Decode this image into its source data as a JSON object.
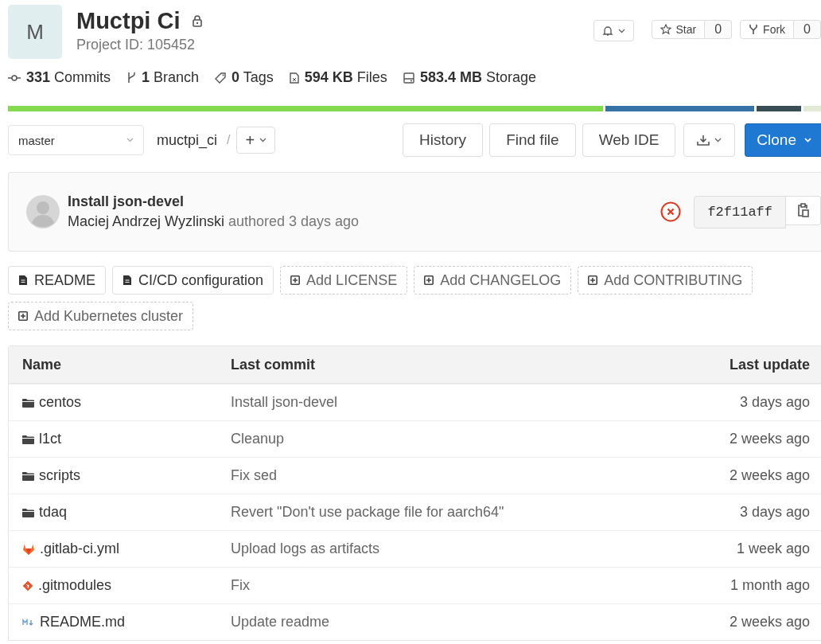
{
  "project": {
    "avatar_letter": "M",
    "name": "Muctpi Ci",
    "private": true,
    "id_text": "Project ID: 105452"
  },
  "actions": {
    "star_label": "Star",
    "star_count": "0",
    "fork_label": "Fork",
    "fork_count": "0"
  },
  "stats": [
    {
      "kind": "commit",
      "text": "**331** Commits"
    },
    {
      "kind": "branch",
      "text": "**1** Branch"
    },
    {
      "kind": "tag",
      "text": "**0** Tags"
    },
    {
      "kind": "files",
      "text": "**594 KB** Files"
    },
    {
      "kind": "storage",
      "text": "**583.4 MB** Storage"
    }
  ],
  "language_bar": [
    {
      "color": "#85d94f"
    },
    {
      "color": "#3572a5"
    },
    {
      "color": "#384d54"
    },
    {
      "color": "#e3ead6"
    }
  ],
  "repo_bar": {
    "branch": "master",
    "path": "muctpi_ci",
    "separator": "/",
    "add_label": "+",
    "buttons": [
      "History",
      "Find file",
      "Web IDE"
    ],
    "clone_label": "Clone"
  },
  "last_commit": {
    "title": "Install json-devel",
    "author": "Maciej Andrzej Wyzlinski",
    "meta": "authored 3 days ago",
    "pipeline_failed": true,
    "sha": "f2f11aff"
  },
  "shortcuts": [
    {
      "kind": "file",
      "label": "README"
    },
    {
      "kind": "file",
      "label": "CI/CD configuration"
    },
    {
      "kind": "add",
      "label": "Add LICENSE"
    },
    {
      "kind": "add",
      "label": "Add CHANGELOG"
    },
    {
      "kind": "add",
      "label": "Add CONTRIBUTING"
    },
    {
      "kind": "add",
      "label": "Add Kubernetes cluster"
    }
  ],
  "table": {
    "columns": [
      "Name",
      "Last commit",
      "Last update"
    ],
    "rows": [
      {
        "kind": "folder",
        "name": "centos",
        "commit": "Install json-devel",
        "updated": "3 days ago"
      },
      {
        "kind": "folder",
        "name": "l1ct",
        "commit": "Cleanup",
        "updated": "2 weeks ago"
      },
      {
        "kind": "folder",
        "name": "scripts",
        "commit": "Fix sed",
        "updated": "2 weeks ago"
      },
      {
        "kind": "folder",
        "name": "tdaq",
        "commit": "Revert \"Don't use package file for aarch64\"",
        "updated": "3 days ago"
      },
      {
        "kind": "gitlab",
        "name": ".gitlab-ci.yml",
        "commit": "Upload logs as artifacts",
        "updated": "1 week ago"
      },
      {
        "kind": "git",
        "name": ".gitmodules",
        "commit": "Fix",
        "updated": "1 month ago"
      },
      {
        "kind": "markdown",
        "name": "README.md",
        "commit": "Update readme",
        "updated": "2 weeks ago"
      }
    ]
  }
}
